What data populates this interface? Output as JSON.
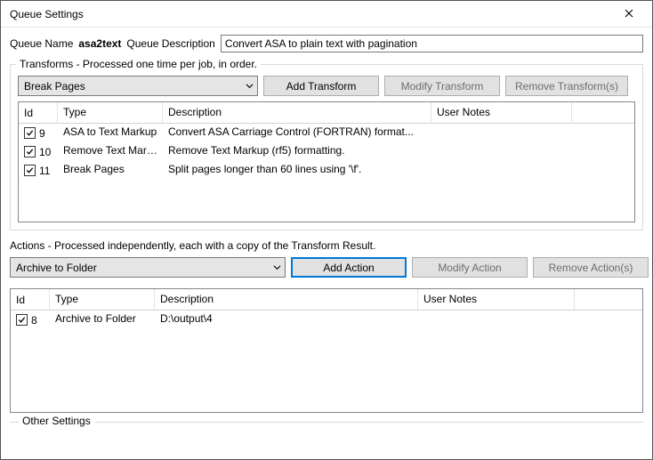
{
  "window": {
    "title": "Queue Settings"
  },
  "header": {
    "name_label": "Queue Name",
    "name_value": "asa2text",
    "desc_label": "Queue Description",
    "desc_value": "Convert ASA to plain text with pagination"
  },
  "transforms": {
    "legend": "Transforms - Processed one time per job, in order.",
    "combo_selected": "Break Pages",
    "buttons": {
      "add": "Add Transform",
      "modify": "Modify Transform",
      "remove": "Remove Transform(s)"
    },
    "columns": {
      "id": "Id",
      "type": "Type",
      "desc": "Description",
      "notes": "User Notes"
    },
    "rows": [
      {
        "checked": true,
        "id": "9",
        "type": "ASA to Text Markup",
        "desc": "Convert ASA Carriage Control (FORTRAN) format...",
        "notes": ""
      },
      {
        "checked": true,
        "id": "10",
        "type": "Remove Text Mark...",
        "desc": "Remove Text Markup (rf5) formatting.",
        "notes": ""
      },
      {
        "checked": true,
        "id": "11",
        "type": "Break Pages",
        "desc": "Split pages longer than 60 lines using '\\f'.",
        "notes": ""
      }
    ]
  },
  "actions": {
    "legend": "Actions - Processed independently, each with a copy of the Transform Result.",
    "combo_selected": "Archive to Folder",
    "buttons": {
      "add": "Add Action",
      "modify": "Modify Action",
      "remove": "Remove Action(s)"
    },
    "columns": {
      "id": "Id",
      "type": "Type",
      "desc": "Description",
      "notes": "User Notes"
    },
    "rows": [
      {
        "checked": true,
        "id": "8",
        "type": "Archive to Folder",
        "desc": "D:\\output\\4",
        "notes": ""
      }
    ]
  },
  "other": {
    "legend": "Other Settings"
  }
}
